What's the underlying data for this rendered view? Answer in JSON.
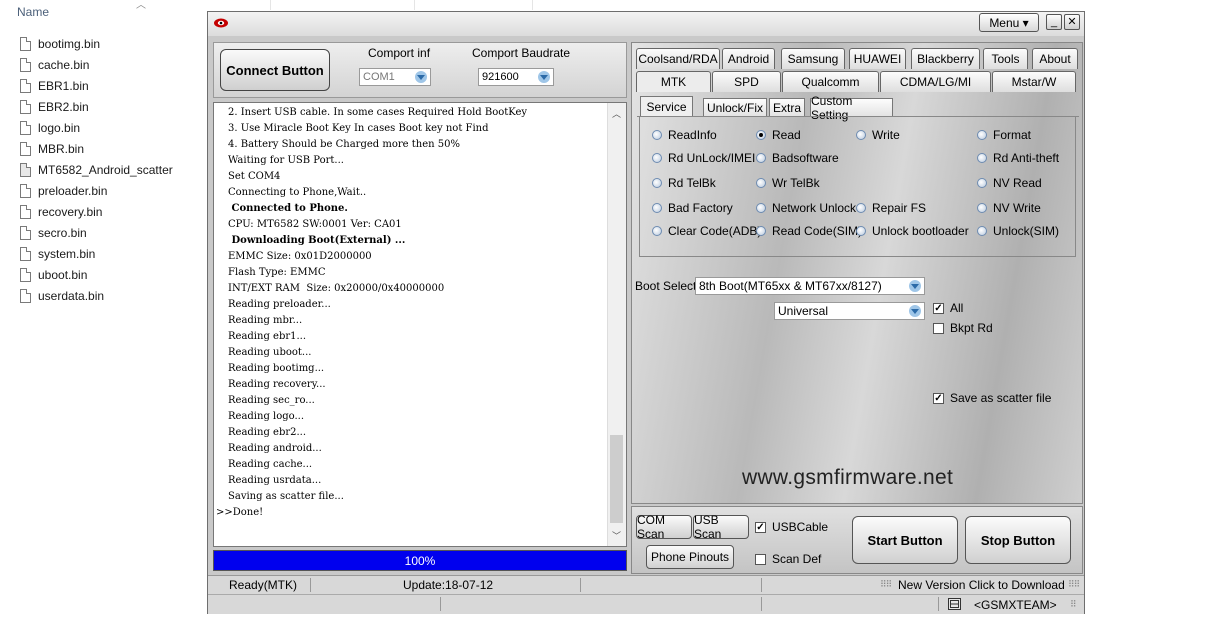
{
  "explorer": {
    "column_name": "Name",
    "files": [
      {
        "name": "bootimg.bin",
        "special": false
      },
      {
        "name": "cache.bin",
        "special": false
      },
      {
        "name": "EBR1.bin",
        "special": false
      },
      {
        "name": "EBR2.bin",
        "special": false
      },
      {
        "name": "logo.bin",
        "special": false
      },
      {
        "name": "MBR.bin",
        "special": false
      },
      {
        "name": "MT6582_Android_scatter",
        "special": true
      },
      {
        "name": "preloader.bin",
        "special": false
      },
      {
        "name": "recovery.bin",
        "special": false
      },
      {
        "name": "secro.bin",
        "special": false
      },
      {
        "name": "system.bin",
        "special": false
      },
      {
        "name": "uboot.bin",
        "special": false
      },
      {
        "name": "userdata.bin",
        "special": false
      }
    ]
  },
  "titlebar": {
    "menu_label": "Menu ▾"
  },
  "connect": {
    "button_label": "Connect Button",
    "comport_label": "Comport inf",
    "comport_value": "COM1",
    "baud_label": "Comport Baudrate",
    "baud_value": "921600"
  },
  "log": {
    "lines": [
      {
        "text": "2. Insert USB cable. In some cases Required Hold BootKey",
        "bold": false
      },
      {
        "text": "3. Use Miracle Boot Key In cases Boot key not Find",
        "bold": false
      },
      {
        "text": "4. Battery Should be Charged more then 50%",
        "bold": false
      },
      {
        "text": "Waiting for USB Port...",
        "bold": false
      },
      {
        "text": "Set COM4",
        "bold": false
      },
      {
        "text": "Connecting to Phone,Wait..",
        "bold": false
      },
      {
        "text": " Connected to Phone.",
        "bold": true
      },
      {
        "text": "CPU: MT6582 SW:0001 Ver: CA01",
        "bold": false
      },
      {
        "text": " Downloading Boot(External) ...",
        "bold": true
      },
      {
        "text": "EMMC Size: 0x01D2000000",
        "bold": false
      },
      {
        "text": "Flash Type: EMMC",
        "bold": false
      },
      {
        "text": "INT/EXT RAM  Size: 0x20000/0x40000000",
        "bold": false
      },
      {
        "text": "Reading preloader...",
        "bold": false
      },
      {
        "text": "Reading mbr...",
        "bold": false
      },
      {
        "text": "Reading ebr1...",
        "bold": false
      },
      {
        "text": "Reading uboot...",
        "bold": false
      },
      {
        "text": "Reading bootimg...",
        "bold": false
      },
      {
        "text": "Reading recovery...",
        "bold": false
      },
      {
        "text": "Reading sec_ro...",
        "bold": false
      },
      {
        "text": "Reading logo...",
        "bold": false
      },
      {
        "text": "Reading ebr2...",
        "bold": false
      },
      {
        "text": "Reading android...",
        "bold": false
      },
      {
        "text": "Reading cache...",
        "bold": false
      },
      {
        "text": "Reading usrdata...",
        "bold": false
      },
      {
        "text": "Saving as scatter file...",
        "bold": false
      },
      {
        "text": ">>Done!",
        "bold": false,
        "outdent": true
      }
    ]
  },
  "progress": {
    "label": "100%",
    "value": 1.0
  },
  "tabs": {
    "row1": [
      "Coolsand/RDA",
      "Android",
      "Samsung",
      "HUAWEI",
      "Blackberry",
      "Tools",
      "About"
    ],
    "row2": [
      "MTK",
      "SPD",
      "Qualcomm",
      "CDMA/LG/MI",
      "Mstar/W"
    ],
    "active": "MTK",
    "sub": [
      "Service",
      "Unlock/Fix",
      "Extra",
      "Custom Setting"
    ],
    "sub_active": "Service"
  },
  "service": {
    "options": [
      {
        "label": "ReadInfo",
        "selected": false
      },
      {
        "label": "Read",
        "selected": true
      },
      {
        "label": "Write",
        "selected": false
      },
      {
        "label": "Format",
        "selected": false
      },
      {
        "label": "Rd UnLock/IMEI",
        "selected": false
      },
      {
        "label": "Badsoftware",
        "selected": false
      },
      {
        "label": "Rd Anti-theft",
        "selected": false
      },
      {
        "label": "Rd TelBk",
        "selected": false
      },
      {
        "label": "Wr TelBk",
        "selected": false
      },
      {
        "label": "NV Read",
        "selected": false
      },
      {
        "label": "Bad Factory",
        "selected": false
      },
      {
        "label": "Network Unlock",
        "selected": false
      },
      {
        "label": "Repair FS",
        "selected": false
      },
      {
        "label": "NV Write",
        "selected": false
      },
      {
        "label": "Clear Code(ADB)",
        "selected": false
      },
      {
        "label": "Read Code(SIM)",
        "selected": false
      },
      {
        "label": "Unlock bootloader",
        "selected": false
      },
      {
        "label": "Unlock(SIM)",
        "selected": false
      }
    ]
  },
  "boot": {
    "label": "Boot Select:",
    "value": "8th Boot(MT65xx & MT67xx/8127)",
    "mode": "Universal",
    "all_label": "All",
    "all_checked": true,
    "bkpt_label": "Bkpt Rd",
    "bkpt_checked": false,
    "scatter_label": "Save as scatter file",
    "scatter_checked": true
  },
  "watermark": "www.gsmfirmware.net",
  "bottom": {
    "com_scan": "COM Scan",
    "usb_scan": "USB Scan",
    "usb_cable_label": "USBCable",
    "usb_cable_checked": true,
    "phone_pinouts": "Phone Pinouts",
    "scan_def_label": "Scan Def",
    "scan_def_checked": false,
    "start": "Start Button",
    "stop": "Stop Button"
  },
  "status": {
    "ready": "Ready(MTK)",
    "update": "Update:18-07-12",
    "new_version": "New Version Click to Download",
    "team": "<GSMXTEAM>"
  }
}
